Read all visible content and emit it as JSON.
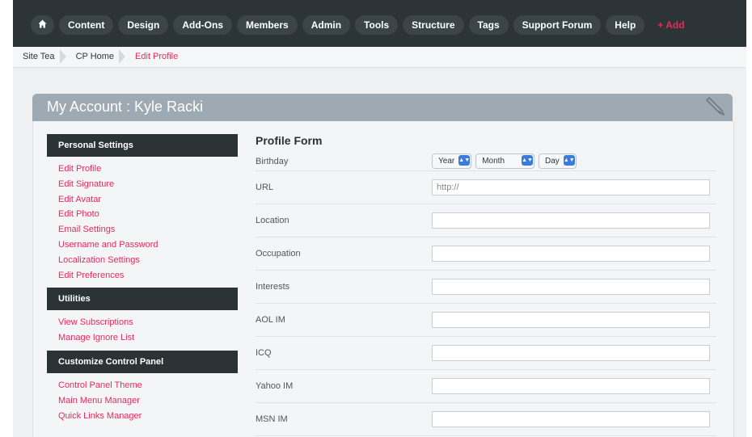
{
  "nav": {
    "home_icon": "home-icon",
    "items": [
      "Content",
      "Design",
      "Add-Ons",
      "Members",
      "Admin",
      "Tools",
      "Structure",
      "Tags",
      "Support Forum",
      "Help"
    ],
    "add_label": "+ Add"
  },
  "breadcrumb": [
    "Site Tea",
    "CP Home",
    "Edit Profile"
  ],
  "panel": {
    "title": "My Account : Kyle Racki",
    "edit_icon": "pencil-icon"
  },
  "sidebar": {
    "sections": [
      {
        "title": "Personal Settings",
        "links": [
          "Edit Profile",
          "Edit Signature",
          "Edit Avatar",
          "Edit Photo",
          "Email Settings",
          "Username and Password",
          "Localization Settings",
          "Edit Preferences"
        ]
      },
      {
        "title": "Utilities",
        "links": [
          "View Subscriptions",
          "Manage Ignore List"
        ]
      },
      {
        "title": "Customize Control Panel",
        "links": [
          "Control Panel Theme",
          "Main Menu Manager",
          "Quick Links Manager"
        ]
      }
    ]
  },
  "form": {
    "title": "Profile Form",
    "birthday": {
      "label": "Birthday",
      "year": "Year",
      "month": "Month",
      "day": "Day"
    },
    "fields": [
      {
        "label": "URL",
        "value": "http://"
      },
      {
        "label": "Location",
        "value": ""
      },
      {
        "label": "Occupation",
        "value": ""
      },
      {
        "label": "Interests",
        "value": ""
      },
      {
        "label": "AOL IM",
        "value": ""
      },
      {
        "label": "ICQ",
        "value": ""
      },
      {
        "label": "Yahoo IM",
        "value": ""
      },
      {
        "label": "MSN IM",
        "value": ""
      }
    ]
  },
  "colors": {
    "accent": "#e8295a",
    "nav_bg": "#2c3438",
    "panel_header": "#9eaab3",
    "select_arrow": "#3b7bdc"
  }
}
